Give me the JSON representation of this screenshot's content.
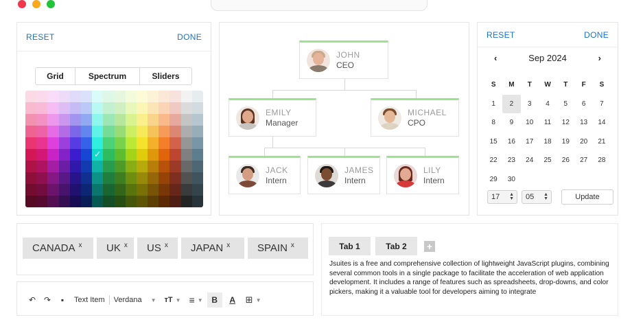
{
  "window": {
    "controls": [
      {
        "name": "close",
        "color": "#f0384d"
      },
      {
        "name": "minimize",
        "color": "#f8a91d"
      },
      {
        "name": "maximize",
        "color": "#1fc43a"
      }
    ]
  },
  "color_picker": {
    "reset_label": "RESET",
    "done_label": "DONE",
    "modes": [
      "Grid",
      "Spectrum",
      "Sliders"
    ],
    "selected_hue_column": 6,
    "selected_row": 5
  },
  "org_chart": {
    "nodes": [
      {
        "id": "john",
        "name": "JOHN",
        "title": "CEO"
      },
      {
        "id": "emily",
        "name": "EMILY",
        "title": "Manager"
      },
      {
        "id": "michael",
        "name": "MICHAEL",
        "title": "CPO"
      },
      {
        "id": "jack",
        "name": "JACK",
        "title": "Intern"
      },
      {
        "id": "james",
        "name": "JAMES",
        "title": "Intern"
      },
      {
        "id": "lily",
        "name": "LILY",
        "title": "Intern"
      }
    ],
    "accent": "#9be38e"
  },
  "calendar": {
    "reset_label": "RESET",
    "done_label": "DONE",
    "month_label": "Sep 2024",
    "prev_icon": "chevron-left-icon",
    "next_icon": "chevron-right-icon",
    "weekdays": [
      "S",
      "M",
      "T",
      "W",
      "T",
      "F",
      "S"
    ],
    "days": [
      "1",
      "2",
      "3",
      "4",
      "5",
      "6",
      "7",
      "8",
      "9",
      "10",
      "11",
      "12",
      "13",
      "14",
      "15",
      "16",
      "17",
      "18",
      "19",
      "20",
      "21",
      "22",
      "23",
      "24",
      "25",
      "26",
      "27",
      "28",
      "29",
      "30"
    ],
    "selected_day": "2",
    "hour": "17",
    "minute": "05",
    "update_label": "Update"
  },
  "tags": {
    "items": [
      "CANADA",
      "UK",
      "US",
      "JAPAN",
      "SPAIN"
    ],
    "remove_glyph": "x"
  },
  "toolbar": {
    "undo_icon": "undo-icon",
    "redo_icon": "redo-icon",
    "save_icon": "save-icon",
    "text_item_label": "Text Item",
    "font_label": "Verdana",
    "font_size_glyph": "тT",
    "align_glyph": "≡",
    "bold_glyph": "B",
    "color_glyph": "A",
    "table_glyph": "⊞"
  },
  "tabs": {
    "labels": [
      "Tab 1",
      "Tab 2"
    ],
    "add_glyph": "+",
    "content": "Jsuites is a free and comprehensive collection of lightweight JavaScript plugins, combining several common tools in a single package to facilitate the acceleration of web application development. It includes a range of features such as spreadsheets, drop-downs, and color pickers, making it a valuable tool for developers aiming to integrate"
  }
}
